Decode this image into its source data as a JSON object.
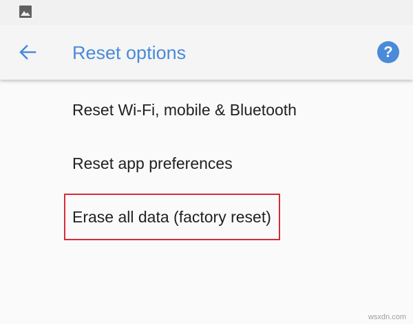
{
  "status_bar": {
    "icon": "image-icon"
  },
  "app_bar": {
    "back_icon": "arrow-back-icon",
    "title": "Reset options",
    "help_icon": "help-icon",
    "help_glyph": "?",
    "accent_color": "#4a8ad9"
  },
  "options": {
    "items": [
      {
        "label": "Reset Wi-Fi, mobile & Bluetooth"
      },
      {
        "label": "Reset app preferences"
      },
      {
        "label": "Erase all data (factory reset)",
        "highlighted": true
      }
    ],
    "highlight_color": "#d62b36"
  },
  "watermark": "wsxdn.com"
}
